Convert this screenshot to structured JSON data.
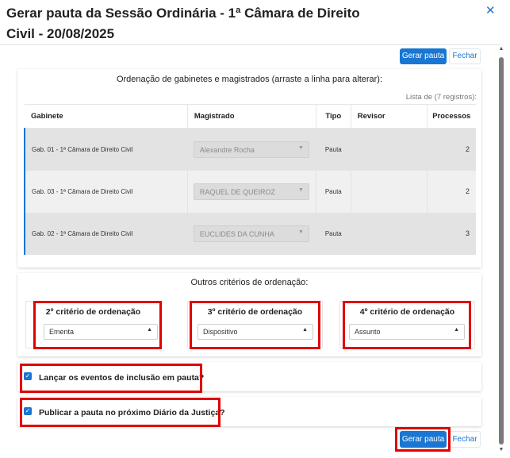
{
  "dialog": {
    "title": "Gerar pauta da Sessão Ordinária - 1ª Câmara de Direito Civil - 20/08/2025",
    "close_icon": "close-icon"
  },
  "toolbar": {
    "gerar_label": "Gerar pauta",
    "fechar_label": "Fechar"
  },
  "ordering": {
    "title": "Ordenação de gabinetes e magistrados (arraste a linha para alterar):",
    "records_text": "Lista de (7 registros):",
    "columns": [
      "Gabinete",
      "Magistrado",
      "Tipo",
      "Revisor",
      "Processos"
    ],
    "rows": [
      {
        "gabinete": "Gab. 01 - 1ª Câmara de Direito Civil",
        "magistrado": "Alexandre Rocha",
        "tipo": "Pauta",
        "revisor": "",
        "processos": "2"
      },
      {
        "gabinete": "Gab. 03 - 1ª Câmara de Direito Civil",
        "magistrado": "RAQUEL DE QUEIROZ",
        "tipo": "Pauta",
        "revisor": "",
        "processos": "2"
      },
      {
        "gabinete": "Gab. 02 - 1ª Câmara de Direito Civil",
        "magistrado": "EUCLIDES DA CUNHA",
        "tipo": "Pauta",
        "revisor": "",
        "processos": "3"
      }
    ]
  },
  "criteria": {
    "title": "Outros critérios de ordenação:",
    "items": [
      {
        "label": "2º critério de ordenação",
        "value": "Ementa"
      },
      {
        "label": "3º critério de ordenação",
        "value": "Dispositivo"
      },
      {
        "label": "4º critério de ordenação",
        "value": "Assunto"
      }
    ]
  },
  "options": {
    "lancar_label": "Lançar os eventos de inclusão em pauta?",
    "lancar_checked": true,
    "publicar_label": "Publicar a pauta no próximo Diário da Justiça?",
    "publicar_checked": true
  },
  "footer": {
    "gerar_label": "Gerar pauta",
    "fechar_label": "Fechar"
  },
  "colors": {
    "accent": "#1976d2",
    "highlight": "#e00000"
  }
}
